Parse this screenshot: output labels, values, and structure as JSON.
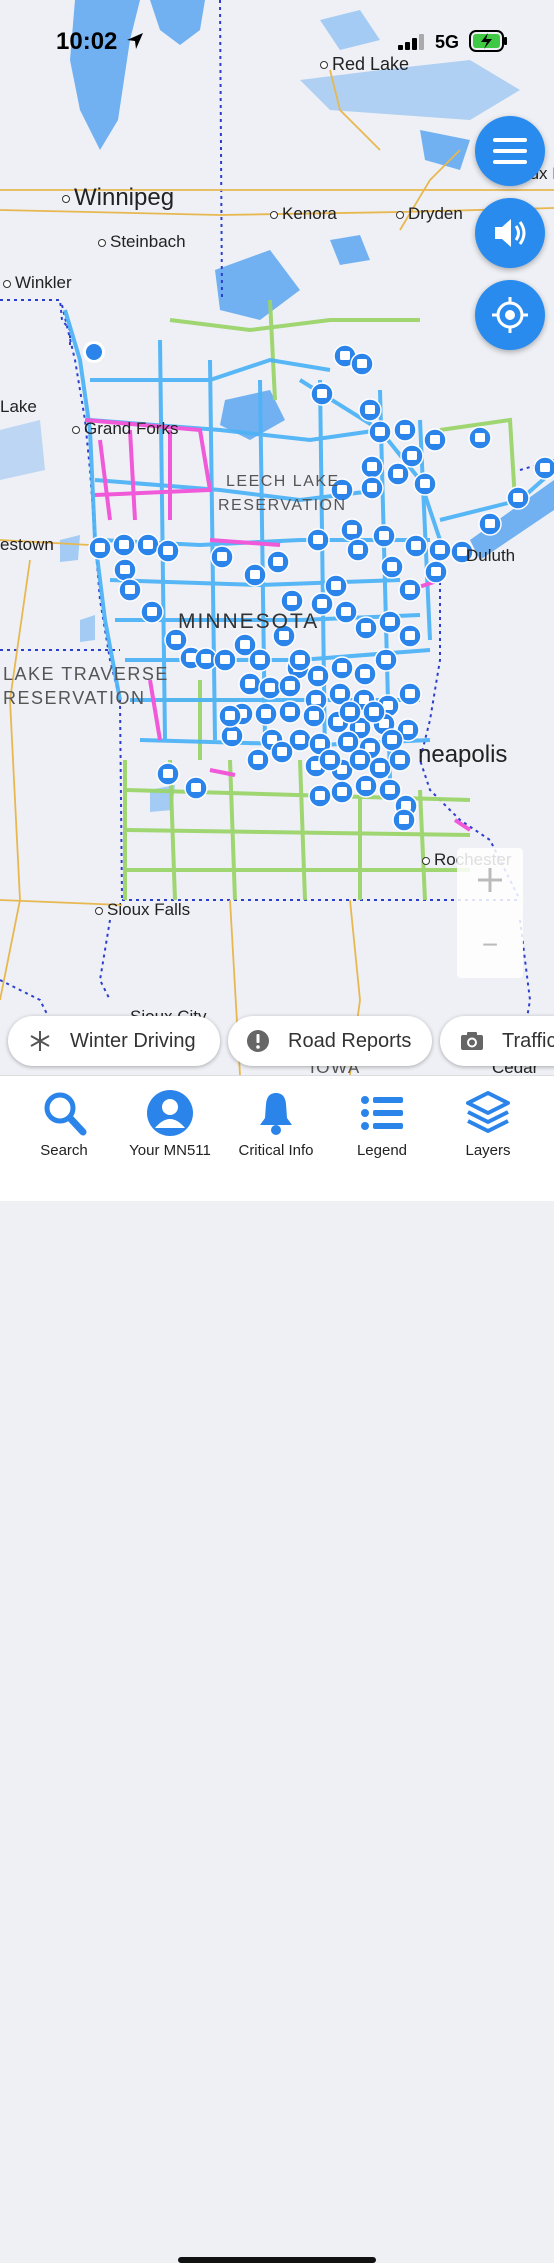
{
  "status_bar": {
    "time": "10:02",
    "network": "5G"
  },
  "map": {
    "places": {
      "red_lake": "Red Lake",
      "winnipeg": "Winnipeg",
      "kenora": "Kenora",
      "dryden": "Dryden",
      "steinbach": "Steinbach",
      "winkler": "Winkler",
      "lake": "Lake",
      "grand_forks": "Grand Forks",
      "leech_lake": "LEECH LAKE",
      "reservation": "RESERVATION",
      "jamestown": "estown",
      "duluth": "Duluth",
      "minnesota": "MINNESOTA",
      "lake_traverse": "LAKE TRAVERSE",
      "reservation2": "RESERVATION",
      "minneapolis": "neapolis",
      "rochester": "Rochester",
      "sioux_falls": "Sioux Falls",
      "sioux_city": "Sioux City",
      "iowa": "IOWA",
      "cedar": "Cedar",
      "sioux_lookout": "Sioux L"
    },
    "zoom_minus": "−",
    "road_colors": {
      "clear": "#9ad46a",
      "partly_covered": "#4fb3f5",
      "covered": "#f05ad8"
    },
    "plow_color": "#2a84ea"
  },
  "controls": {
    "menu": "menu-icon",
    "sound": "speaker-icon",
    "locate": "locate-icon"
  },
  "chips": [
    {
      "label": "Winter Driving",
      "icon": "snowflake-icon"
    },
    {
      "label": "Road Reports",
      "icon": "alert-icon"
    },
    {
      "label": "Traffic",
      "icon": "camera-icon"
    }
  ],
  "tabs": [
    {
      "label": "Search",
      "icon": "search-icon"
    },
    {
      "label": "Your MN511",
      "icon": "user-icon"
    },
    {
      "label": "Critical Info",
      "icon": "bell-icon"
    },
    {
      "label": "Legend",
      "icon": "list-icon"
    },
    {
      "label": "Layers",
      "icon": "layers-icon"
    }
  ]
}
